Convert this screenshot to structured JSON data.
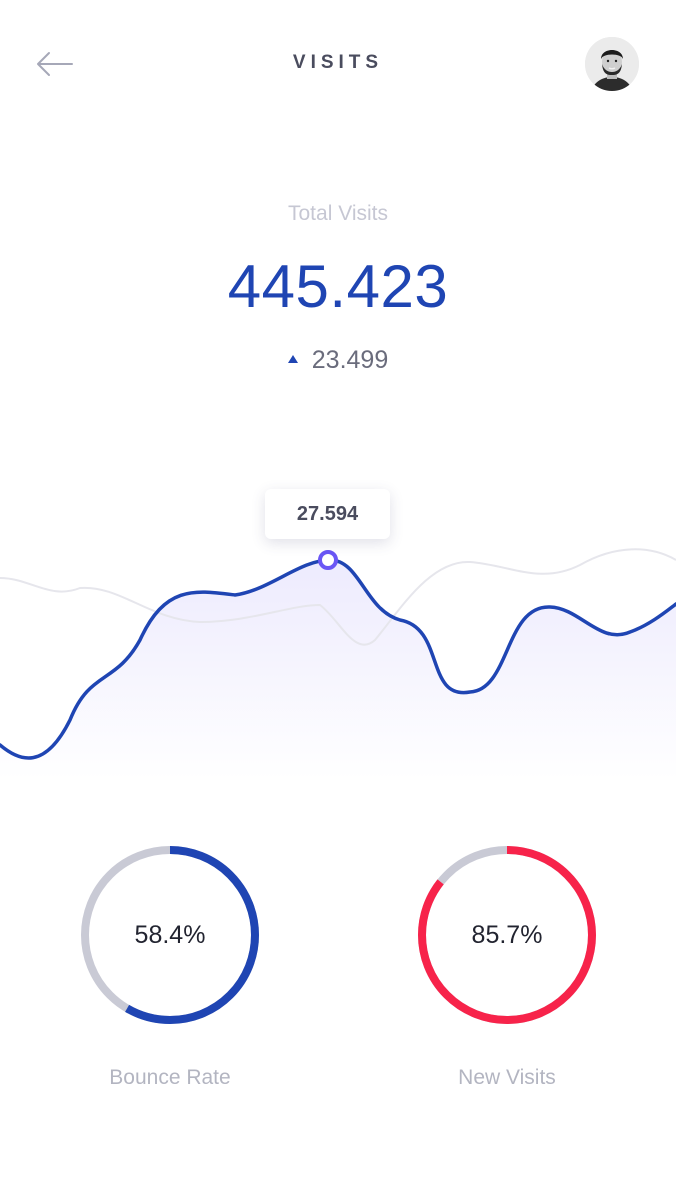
{
  "header": {
    "title": "VISITS"
  },
  "summary": {
    "label": "Total Visits",
    "value": "445.423",
    "delta": "23.499"
  },
  "tooltip": {
    "value": "27.594"
  },
  "metrics": [
    {
      "value": "58.4%",
      "label": "Bounce Rate",
      "fraction": 0.584,
      "color": "#1f45b3"
    },
    {
      "value": "85.7%",
      "label": "New Visits",
      "fraction": 0.857,
      "color": "#f7234a"
    }
  ],
  "colors": {
    "primary": "#1f45b3",
    "accent": "#f7234a",
    "track": "#c9cad5",
    "highlight": "#6a56f5"
  },
  "icons": {
    "back": "arrow-left-icon",
    "delta": "triangle-up-icon"
  }
}
